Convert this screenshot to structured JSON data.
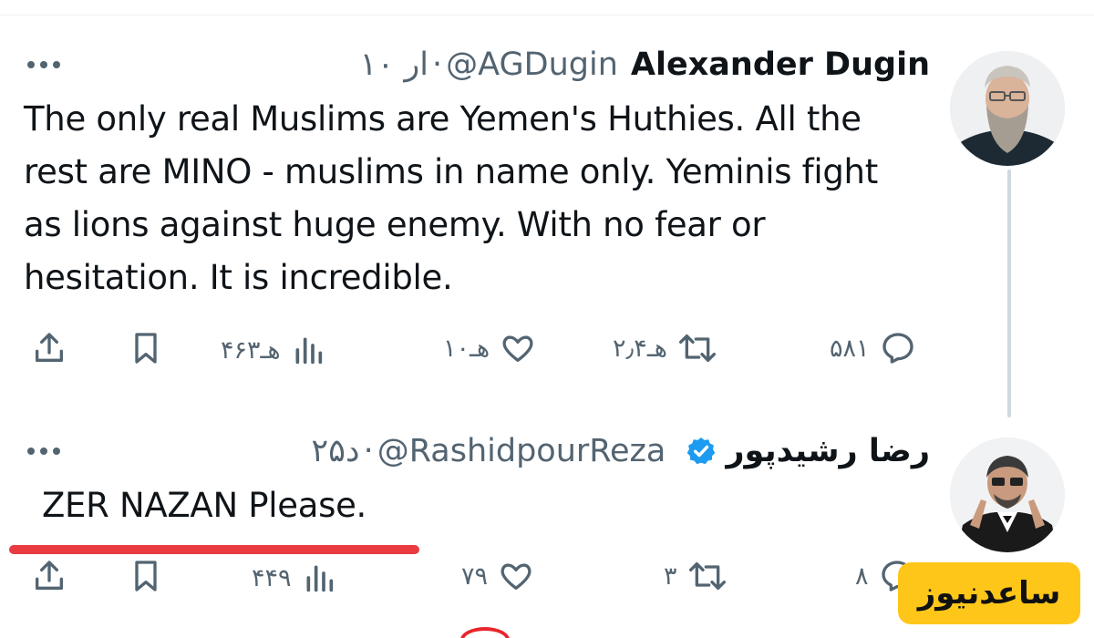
{
  "tweet1": {
    "name": "Alexander Dugin",
    "handle": "@AGDugin",
    "separator": "·",
    "time": "۱۰ ار",
    "text": "The only real Muslims are Yemen's Huthies. All the rest are MINO - muslims in name only. Yeminis fight as lions against huge enemy. With no fear or hesitation. It is incredible.",
    "actions": {
      "replies": "۵۸۱",
      "retweets": "۲٫۴هـ",
      "likes": "۱۰هـ",
      "views": "۴۶۳هـ"
    },
    "avatar_icon": "bearded-man-avatar"
  },
  "tweet2": {
    "name": "رضا رشیدپور",
    "handle": "@RashidpourReza",
    "separator": "·",
    "time": "۲۵د",
    "verified": true,
    "text": "ZER NAZAN Please.",
    "actions": {
      "replies": "۸",
      "retweets": "۳",
      "likes": "۷۹",
      "views": "۴۴۹"
    },
    "avatar_icon": "man-in-suit-avatar"
  },
  "watermark": {
    "text": "ساعدنیوز"
  },
  "colors": {
    "text": "#0f1419",
    "muted": "#536471",
    "verified": "#1d9bf0",
    "underline": "#e8262b",
    "watermark_bg": "#ffc61a"
  }
}
